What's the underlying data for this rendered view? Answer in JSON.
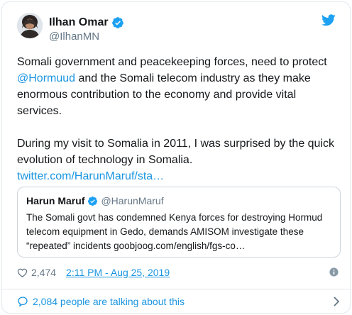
{
  "tweet": {
    "author_name": "Ilhan Omar",
    "author_handle": "@IlhanMN",
    "paragraph1_a": "Somali government and peacekeeping forces, need to protect ",
    "mention": "@Hormuud",
    "paragraph1_b": " and the Somali telecom industry as they make enormous contribution to the economy and provide vital services.",
    "paragraph2": "During my visit to Somalia in 2011, I was surprised by the quick evolution of technology in Somalia.",
    "link": "twitter.com/HarunMaruf/sta…"
  },
  "quote": {
    "author_name": "Harun Maruf",
    "author_handle": "@HarunMaruf",
    "text": "The Somali govt has condemned Kenya forces for destroying Hormud telecom equipment in Gedo, demands AMISOM investigate these “repeated” incidents  goobjoog.com/english/fgs-co…"
  },
  "meta": {
    "likes": "2,474",
    "timestamp": "2:11 PM - Aug 25, 2019"
  },
  "footer": {
    "talking": "2,084 people are talking about this"
  },
  "colors": {
    "link": "#1b95e0",
    "verified": "#1da1f2",
    "twitter_bird": "#1da1f2",
    "secondary_text": "#657786"
  },
  "icons": [
    "verified-badge-icon",
    "twitter-bird-icon",
    "heart-icon",
    "info-icon",
    "comment-bubble-icon",
    "chevron-right-icon"
  ]
}
